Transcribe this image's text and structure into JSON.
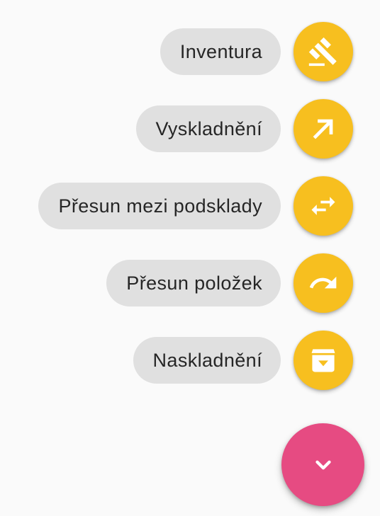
{
  "speed_dial": {
    "actions": [
      {
        "label": "Inventura",
        "icon": "gavel-icon"
      },
      {
        "label": "Vyskladnění",
        "icon": "arrow-outward-icon"
      },
      {
        "label": "Přesun mezi podsklady",
        "icon": "swap-horiz-icon"
      },
      {
        "label": "Přesun položek",
        "icon": "redo-icon"
      },
      {
        "label": "Naskladnění",
        "icon": "archive-icon"
      }
    ],
    "toggle_icon": "chevron-down-icon",
    "colors": {
      "action_fab": "#f7bf1f",
      "main_fab": "#e64b82",
      "label_bg": "#e0e0e0",
      "icon": "#ffffff"
    }
  }
}
